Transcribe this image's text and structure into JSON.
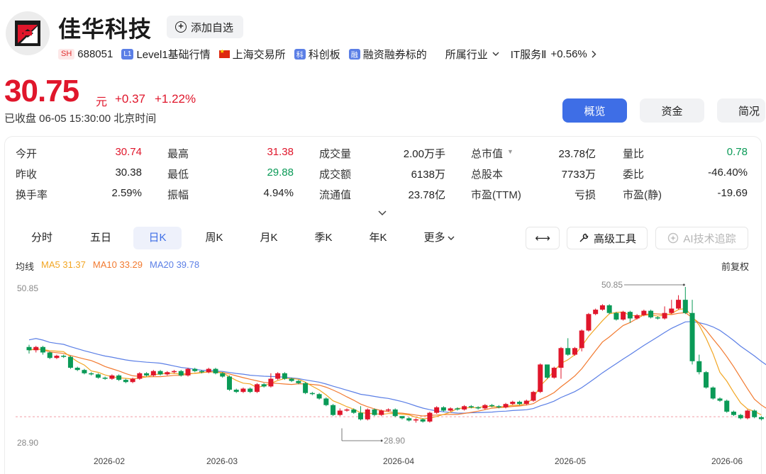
{
  "header": {
    "name": "佳华科技",
    "watch_label": "添加自选",
    "market_badge": "SH",
    "code": "688051",
    "level1_badge": "L1",
    "level1": "Level1基础行情",
    "exchange": "上海交易所",
    "star_badge": "科",
    "star": "科创板",
    "margin_badge": "融",
    "margin": "融资融券标的",
    "industry_label": "所属行业",
    "industry_name": "IT服务Ⅱ",
    "industry_chg": "+0.56%"
  },
  "quote": {
    "price": "30.75",
    "unit": "元",
    "change": "+0.37",
    "change_pct": "+1.22%",
    "status": "已收盘 06-05 15:30:00 北京时间"
  },
  "top_tabs": [
    "概览",
    "资金",
    "简况"
  ],
  "stats": {
    "rows": [
      [
        {
          "label": "今开",
          "value": "30.74",
          "color": "red"
        },
        {
          "label": "最高",
          "value": "31.38",
          "color": "red"
        },
        {
          "label": "成交量",
          "value": "2.00万手",
          "color": ""
        },
        {
          "label": "总市值",
          "value": "23.78亿",
          "color": "",
          "caret": "▼"
        },
        {
          "label": "量比",
          "value": "0.78",
          "color": "green"
        }
      ],
      [
        {
          "label": "昨收",
          "value": "30.38",
          "color": ""
        },
        {
          "label": "最低",
          "value": "29.88",
          "color": "green"
        },
        {
          "label": "成交额",
          "value": "6138万",
          "color": ""
        },
        {
          "label": "总股本",
          "value": "7733万",
          "color": ""
        },
        {
          "label": "委比",
          "value": "-46.40%",
          "color": ""
        }
      ],
      [
        {
          "label": "换手率",
          "value": "2.59%",
          "color": ""
        },
        {
          "label": "振幅",
          "value": "4.94%",
          "color": ""
        },
        {
          "label": "流通值",
          "value": "23.78亿",
          "color": ""
        },
        {
          "label": "市盈(TTM)",
          "value": "亏损",
          "color": ""
        },
        {
          "label": "市盈(静)",
          "value": "-19.69",
          "color": ""
        }
      ]
    ]
  },
  "period_tabs": [
    "分时",
    "五日",
    "日K",
    "周K",
    "月K",
    "季K",
    "年K",
    "更多"
  ],
  "tools": {
    "expand_icon": "⟷",
    "advanced": "高级工具",
    "ai": "AI技术追踪"
  },
  "ma": {
    "label": "均线",
    "ma5": "MA5 31.37",
    "ma10": "MA10 33.29",
    "ma20": "MA20 39.78",
    "adj": "前复权"
  },
  "colors": {
    "up": "#e0162b",
    "down": "#0a9a57",
    "ma5": "#f2a623",
    "ma10": "#f27a30",
    "ma20": "#5b7fe6",
    "accent": "#3e6ee6"
  },
  "chart_data": {
    "type": "candlestick",
    "y_top_label": "50.85",
    "y_bottom_label": "28.90",
    "ylim": [
      28.9,
      50.85
    ],
    "max_annotation": "50.85",
    "min_annotation": "28.90",
    "last_price_line": 30.75,
    "x_ticks": [
      "2026-02",
      "2026-03",
      "2026-04",
      "2026-05",
      "2026-06"
    ],
    "candles": [
      [
        41.55,
        41.05,
        41.89,
        40.53
      ],
      [
        41.05,
        41.55,
        41.72,
        40.7
      ],
      [
        41.55,
        40.7,
        41.72,
        40.36
      ],
      [
        40.7,
        39.85,
        40.87,
        39.68
      ],
      [
        39.85,
        40.19,
        40.36,
        39.68
      ],
      [
        40.19,
        40.02,
        40.36,
        39.85
      ],
      [
        40.02,
        38.33,
        40.19,
        38.16
      ],
      [
        38.33,
        37.99,
        38.5,
        37.82
      ],
      [
        37.99,
        37.48,
        38.16,
        37.31
      ],
      [
        37.48,
        37.31,
        37.65,
        37.14
      ],
      [
        37.31,
        36.8,
        37.48,
        36.63
      ],
      [
        36.8,
        36.63,
        36.97,
        36.46
      ],
      [
        36.63,
        37.14,
        37.31,
        36.46
      ],
      [
        37.14,
        36.46,
        37.31,
        36.29
      ],
      [
        36.46,
        36.12,
        36.63,
        35.95
      ],
      [
        36.12,
        36.63,
        36.8,
        35.95
      ],
      [
        36.63,
        37.48,
        37.65,
        36.46
      ],
      [
        37.48,
        37.14,
        37.65,
        36.97
      ],
      [
        37.14,
        37.82,
        37.99,
        36.97
      ],
      [
        37.82,
        37.31,
        37.99,
        37.14
      ],
      [
        37.31,
        37.65,
        37.82,
        37.14
      ],
      [
        37.65,
        37.82,
        37.99,
        37.48
      ],
      [
        37.82,
        37.14,
        37.99,
        36.97
      ],
      [
        37.14,
        38.16,
        38.33,
        36.97
      ],
      [
        38.16,
        37.82,
        38.33,
        37.65
      ],
      [
        37.82,
        37.65,
        37.99,
        37.48
      ],
      [
        37.65,
        38.16,
        38.33,
        37.48
      ],
      [
        38.16,
        37.48,
        38.33,
        37.31
      ],
      [
        37.48,
        36.97,
        37.65,
        36.8
      ],
      [
        36.97,
        34.93,
        37.14,
        34.76
      ],
      [
        34.93,
        34.59,
        35.1,
        34.42
      ],
      [
        34.59,
        35.1,
        35.27,
        34.42
      ],
      [
        35.1,
        34.59,
        35.27,
        34.42
      ],
      [
        34.59,
        35.78,
        35.95,
        34.42
      ],
      [
        35.78,
        35.44,
        35.95,
        35.27
      ],
      [
        35.44,
        36.63,
        37.48,
        35.27
      ],
      [
        36.63,
        37.48,
        37.65,
        36.46
      ],
      [
        37.48,
        36.63,
        37.65,
        36.46
      ],
      [
        36.63,
        36.29,
        36.8,
        36.12
      ],
      [
        36.29,
        35.95,
        36.46,
        35.78
      ],
      [
        35.95,
        34.42,
        36.12,
        34.25
      ],
      [
        34.42,
        34.25,
        34.59,
        34.08
      ],
      [
        34.25,
        33.57,
        34.42,
        33.4
      ],
      [
        33.57,
        32.55,
        33.74,
        32.38
      ],
      [
        32.55,
        31.02,
        32.72,
        30.85
      ],
      [
        31.02,
        31.7,
        32.04,
        30.85
      ],
      [
        31.7,
        31.87,
        32.04,
        31.53
      ],
      [
        31.87,
        31.36,
        32.04,
        31.19
      ],
      [
        31.36,
        30.34,
        32.38,
        30.17
      ],
      [
        30.34,
        31.87,
        32.04,
        30.17
      ],
      [
        31.87,
        31.02,
        32.04,
        30.85
      ],
      [
        31.02,
        31.7,
        31.87,
        30.85
      ],
      [
        31.7,
        31.87,
        32.04,
        31.53
      ],
      [
        31.87,
        30.85,
        32.04,
        30.68
      ],
      [
        30.85,
        30.51,
        30.68,
        30.34
      ],
      [
        30.51,
        30.17,
        30.68,
        30.0
      ],
      [
        30.17,
        30.34,
        30.51,
        29.83
      ],
      [
        30.34,
        30.0,
        30.51,
        29.83
      ],
      [
        30.0,
        31.36,
        31.53,
        29.83
      ],
      [
        31.36,
        32.21,
        32.38,
        31.19
      ],
      [
        32.21,
        31.7,
        32.38,
        31.53
      ],
      [
        31.7,
        32.04,
        32.21,
        31.53
      ],
      [
        32.04,
        31.87,
        32.21,
        31.7
      ],
      [
        31.87,
        32.38,
        32.55,
        31.7
      ],
      [
        32.38,
        32.21,
        32.55,
        32.04
      ],
      [
        32.21,
        32.04,
        32.38,
        31.87
      ],
      [
        32.04,
        32.55,
        32.72,
        31.87
      ],
      [
        32.55,
        32.38,
        32.72,
        32.21
      ],
      [
        32.38,
        32.21,
        32.55,
        32.04
      ],
      [
        32.21,
        32.72,
        32.89,
        32.04
      ],
      [
        32.72,
        33.06,
        33.23,
        32.55
      ],
      [
        33.06,
        32.72,
        33.23,
        32.55
      ],
      [
        32.72,
        33.23,
        33.4,
        32.55
      ],
      [
        33.23,
        34.59,
        34.76,
        33.06
      ],
      [
        34.59,
        38.84,
        39.01,
        34.42
      ],
      [
        38.84,
        36.8,
        38.33,
        36.63
      ],
      [
        36.8,
        38.33,
        38.5,
        36.63
      ],
      [
        38.33,
        41.38,
        41.55,
        36.63
      ],
      [
        41.38,
        40.36,
        42.91,
        40.19
      ],
      [
        40.36,
        41.38,
        41.55,
        40.19
      ],
      [
        41.38,
        44.1,
        44.27,
        40.87
      ],
      [
        44.1,
        46.65,
        46.82,
        43.93
      ],
      [
        46.65,
        47.33,
        47.5,
        46.48
      ],
      [
        47.33,
        48.01,
        48.18,
        47.16
      ],
      [
        48.01,
        46.82,
        48.18,
        46.65
      ],
      [
        46.82,
        45.8,
        46.99,
        45.63
      ],
      [
        45.8,
        46.99,
        47.16,
        45.63
      ],
      [
        46.99,
        45.97,
        47.16,
        45.29
      ],
      [
        45.97,
        46.48,
        46.65,
        45.8
      ],
      [
        46.48,
        47.16,
        47.33,
        46.31
      ],
      [
        47.16,
        46.14,
        47.33,
        45.97
      ],
      [
        46.14,
        45.97,
        46.31,
        45.8
      ],
      [
        45.97,
        46.82,
        47.84,
        45.8
      ],
      [
        46.82,
        47.5,
        48.86,
        46.65
      ],
      [
        47.5,
        48.86,
        49.57,
        47.33
      ],
      [
        48.86,
        46.82,
        50.85,
        46.65
      ],
      [
        46.82,
        39.35,
        48.86,
        38.84
      ],
      [
        39.35,
        37.65,
        40.36,
        37.31
      ],
      [
        37.65,
        35.27,
        37.82,
        35.1
      ],
      [
        35.27,
        33.57,
        35.44,
        33.4
      ],
      [
        33.57,
        33.23,
        33.74,
        33.06
      ],
      [
        33.23,
        31.53,
        33.4,
        31.36
      ],
      [
        31.53,
        31.02,
        31.7,
        30.85
      ],
      [
        31.02,
        30.51,
        31.19,
        30.34
      ],
      [
        30.51,
        31.7,
        31.87,
        30.34
      ],
      [
        31.7,
        30.68,
        31.87,
        30.51
      ],
      [
        30.68,
        30.38,
        30.85,
        30.17
      ],
      [
        30.74,
        30.75,
        31.38,
        29.88
      ]
    ],
    "ma5": [
      41.05,
      41.22,
      41.15,
      40.99,
      40.91,
      40.83,
      40.02,
      39.28,
      38.76,
      37.83,
      37.63,
      37.22,
      36.95,
      36.79,
      36.69,
      36.58,
      36.76,
      36.9,
      37.29,
      37.35,
      37.49,
      37.45,
      37.35,
      37.44,
      37.46,
      37.56,
      37.75,
      37.64,
      37.56,
      36.95,
      36.37,
      35.95,
      35.84,
      35.27,
      35.53,
      35.93,
      36.35,
      36.67,
      36.67,
      36.55,
      36.1,
      35.47,
      34.89,
      34.12,
      33.21,
      32.79,
      32.3,
      31.92,
      31.37,
      31.28,
      31.23,
      31.12,
      31.24,
      31.24,
      31.14,
      31.04,
      30.67,
      30.44,
      30.52,
      30.79,
      31.11,
      31.45,
      32.03,
      32.09,
      32.17,
      32.15,
      32.35,
      32.35,
      32.27,
      32.35,
      32.52,
      32.53,
      32.82,
      33.6,
      35.54,
      36.61,
      37.82,
      39.01,
      39.57,
      40.36,
      41.67,
      43.18,
      44.42,
      45.61,
      46.7,
      46.9,
      46.99,
      46.45,
      46.37,
      46.48,
      46.52,
      46.33,
      46.48,
      46.74,
      47.34,
      47.51,
      46.28,
      44.92,
      42.92,
      40.51,
      37.62,
      36.26,
      34.51,
      32.89,
      31.95,
      31.57,
      31.04
    ]
  }
}
